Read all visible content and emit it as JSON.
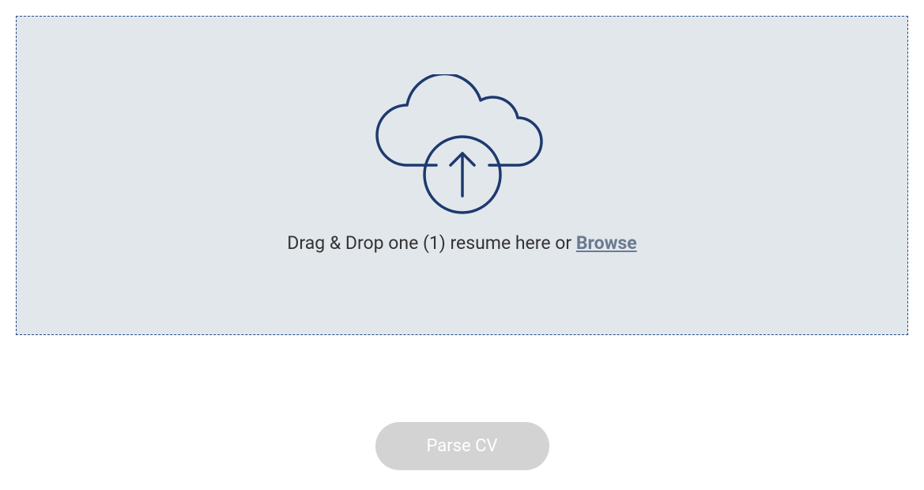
{
  "dropzone": {
    "instruction_text": "Drag & Drop one (1) resume here or ",
    "browse_label": "Browse"
  },
  "actions": {
    "parse_button_label": "Parse CV"
  },
  "colors": {
    "dropzone_border": "#214b8b",
    "dropzone_bg": "#e2e7ec",
    "icon_stroke": "#1d3a6e",
    "button_disabled_bg": "#d3d3d3",
    "button_text": "#ffffff",
    "browse_link": "#6b7a8f",
    "instruction_text": "#333333"
  },
  "icons": {
    "cloud_upload": "cloud-upload-icon"
  }
}
